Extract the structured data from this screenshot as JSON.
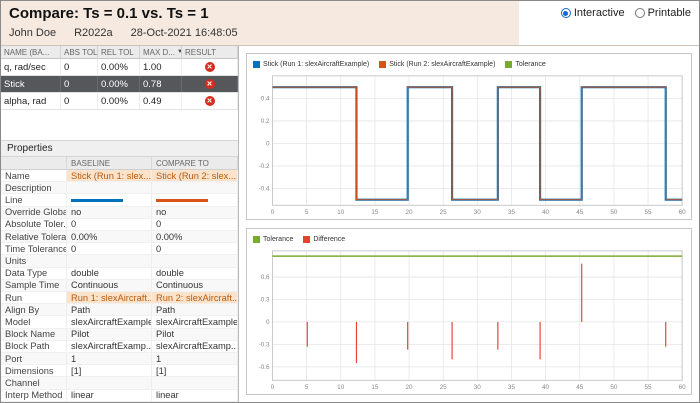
{
  "header": {
    "title": "Compare: Ts = 0.1 vs. Ts = 1",
    "user": "John Doe",
    "release": "R2022a",
    "timestamp": "28-Oct-2021 16:48:05",
    "view_options": [
      {
        "label": "Interactive",
        "selected": true
      },
      {
        "label": "Printable",
        "selected": false
      }
    ]
  },
  "signals_table": {
    "columns": [
      "NAME (BA...",
      "ABS TOL",
      "REL TOL",
      "MAX D...",
      "RESULT"
    ],
    "sort_column_index": 3,
    "rows": [
      {
        "name": "q, rad/sec",
        "abs_tol": "0",
        "rel_tol": "0.00%",
        "max_diff": "1.00",
        "result": "fail",
        "selected": false
      },
      {
        "name": "Stick",
        "abs_tol": "0",
        "rel_tol": "0.00%",
        "max_diff": "0.78",
        "result": "fail",
        "selected": true
      },
      {
        "name": "alpha, rad",
        "abs_tol": "0",
        "rel_tol": "0.00%",
        "max_diff": "0.49",
        "result": "fail",
        "selected": false
      }
    ]
  },
  "properties": {
    "section_title": "Properties",
    "columns": [
      "",
      "BASELINE",
      "COMPARE TO"
    ],
    "rows": [
      {
        "label": "Name",
        "baseline": "Stick (Run 1: slex...",
        "compare": "Stick (Run 2: slex...",
        "highlight": true
      },
      {
        "label": "Description",
        "baseline": "",
        "compare": ""
      },
      {
        "label": "Line",
        "baseline": "",
        "compare": "",
        "swatch": true
      },
      {
        "label": "Override Globa...",
        "baseline": "no",
        "compare": "no"
      },
      {
        "label": "Absolute Toler...",
        "baseline": "0",
        "compare": "0"
      },
      {
        "label": "Relative Tolera...",
        "baseline": "0.00%",
        "compare": "0.00%"
      },
      {
        "label": "Time Tolerance",
        "baseline": "0",
        "compare": "0"
      },
      {
        "label": "Units",
        "baseline": "",
        "compare": ""
      },
      {
        "label": "Data Type",
        "baseline": "double",
        "compare": "double"
      },
      {
        "label": "Sample Time",
        "baseline": "Continuous",
        "compare": "Continuous"
      },
      {
        "label": "Run",
        "baseline": "Run 1: slexAircraft...",
        "compare": "Run 2: slexAircraft...",
        "highlight": true
      },
      {
        "label": "Align By",
        "baseline": "Path",
        "compare": "Path"
      },
      {
        "label": "Model",
        "baseline": "slexAircraftExample",
        "compare": "slexAircraftExample"
      },
      {
        "label": "Block Name",
        "baseline": "Pilot",
        "compare": "Pilot"
      },
      {
        "label": "Block Path",
        "baseline": "slexAircraftExamp...",
        "compare": "slexAircraftExamp..."
      },
      {
        "label": "Port",
        "baseline": "1",
        "compare": "1"
      },
      {
        "label": "Dimensions",
        "baseline": "[1]",
        "compare": "[1]"
      },
      {
        "label": "Channel",
        "baseline": "",
        "compare": ""
      },
      {
        "label": "Interp Method",
        "baseline": "linear",
        "compare": "linear"
      }
    ]
  },
  "colors": {
    "baseline_line": "#0072BD",
    "compare_line": "#D95319",
    "tolerance": "#77AC30",
    "difference": "#E2442F",
    "fail": "#D22D1E",
    "header_bg": "#F6E9DF",
    "selected_row_bg": "#56575B",
    "highlight_bg": "#FBE3CB",
    "highlight_text": "#B55A10"
  },
  "chart_data": [
    {
      "type": "line",
      "subtype": "step",
      "title": "",
      "xlabel": "",
      "ylabel": "",
      "xlim": [
        0,
        60
      ],
      "ylim": [
        -0.55,
        0.6
      ],
      "xticks": [
        0,
        5,
        10,
        15,
        20,
        25,
        30,
        35,
        40,
        45,
        50,
        55,
        60
      ],
      "yticks": [
        0.4,
        0.2,
        0,
        -0.2,
        -0.4
      ],
      "grid": true,
      "legend_position": "top",
      "legend": [
        {
          "label": "Stick (Run 1: slexAircraftExample)",
          "color": "#0072BD"
        },
        {
          "label": "Stick (Run 2: slexAircraftExample)",
          "color": "#D95319"
        },
        {
          "label": "Tolerance",
          "color": "#77AC30"
        }
      ],
      "step_x": [
        0,
        12.3,
        19.8,
        26.3,
        33,
        39.2,
        45.3,
        57.6,
        60
      ],
      "step_values": [
        0.5,
        -0.5,
        0.5,
        -0.5,
        0.5,
        -0.5,
        0.5,
        -0.5
      ]
    },
    {
      "type": "stem",
      "title": "",
      "xlabel": "",
      "ylabel": "",
      "xlim": [
        0,
        60
      ],
      "ylim": [
        -0.78,
        0.95
      ],
      "xticks": [
        0,
        5,
        10,
        15,
        20,
        25,
        30,
        35,
        40,
        45,
        50,
        55,
        60
      ],
      "yticks": [
        0.6,
        0.3,
        0,
        -0.3,
        -0.6
      ],
      "grid": true,
      "legend_position": "top",
      "legend": [
        {
          "label": "Tolerance",
          "color": "#77AC30"
        },
        {
          "label": "Difference",
          "color": "#E2442F"
        }
      ],
      "tolerance_y": 0.88,
      "stems": [
        [
          5.1,
          -0.33
        ],
        [
          12.3,
          -0.55
        ],
        [
          19.8,
          -0.37
        ],
        [
          26.3,
          -0.5
        ],
        [
          33,
          -0.37
        ],
        [
          39.2,
          -0.5
        ],
        [
          45.3,
          0.78
        ],
        [
          57.6,
          -0.33
        ]
      ]
    }
  ]
}
